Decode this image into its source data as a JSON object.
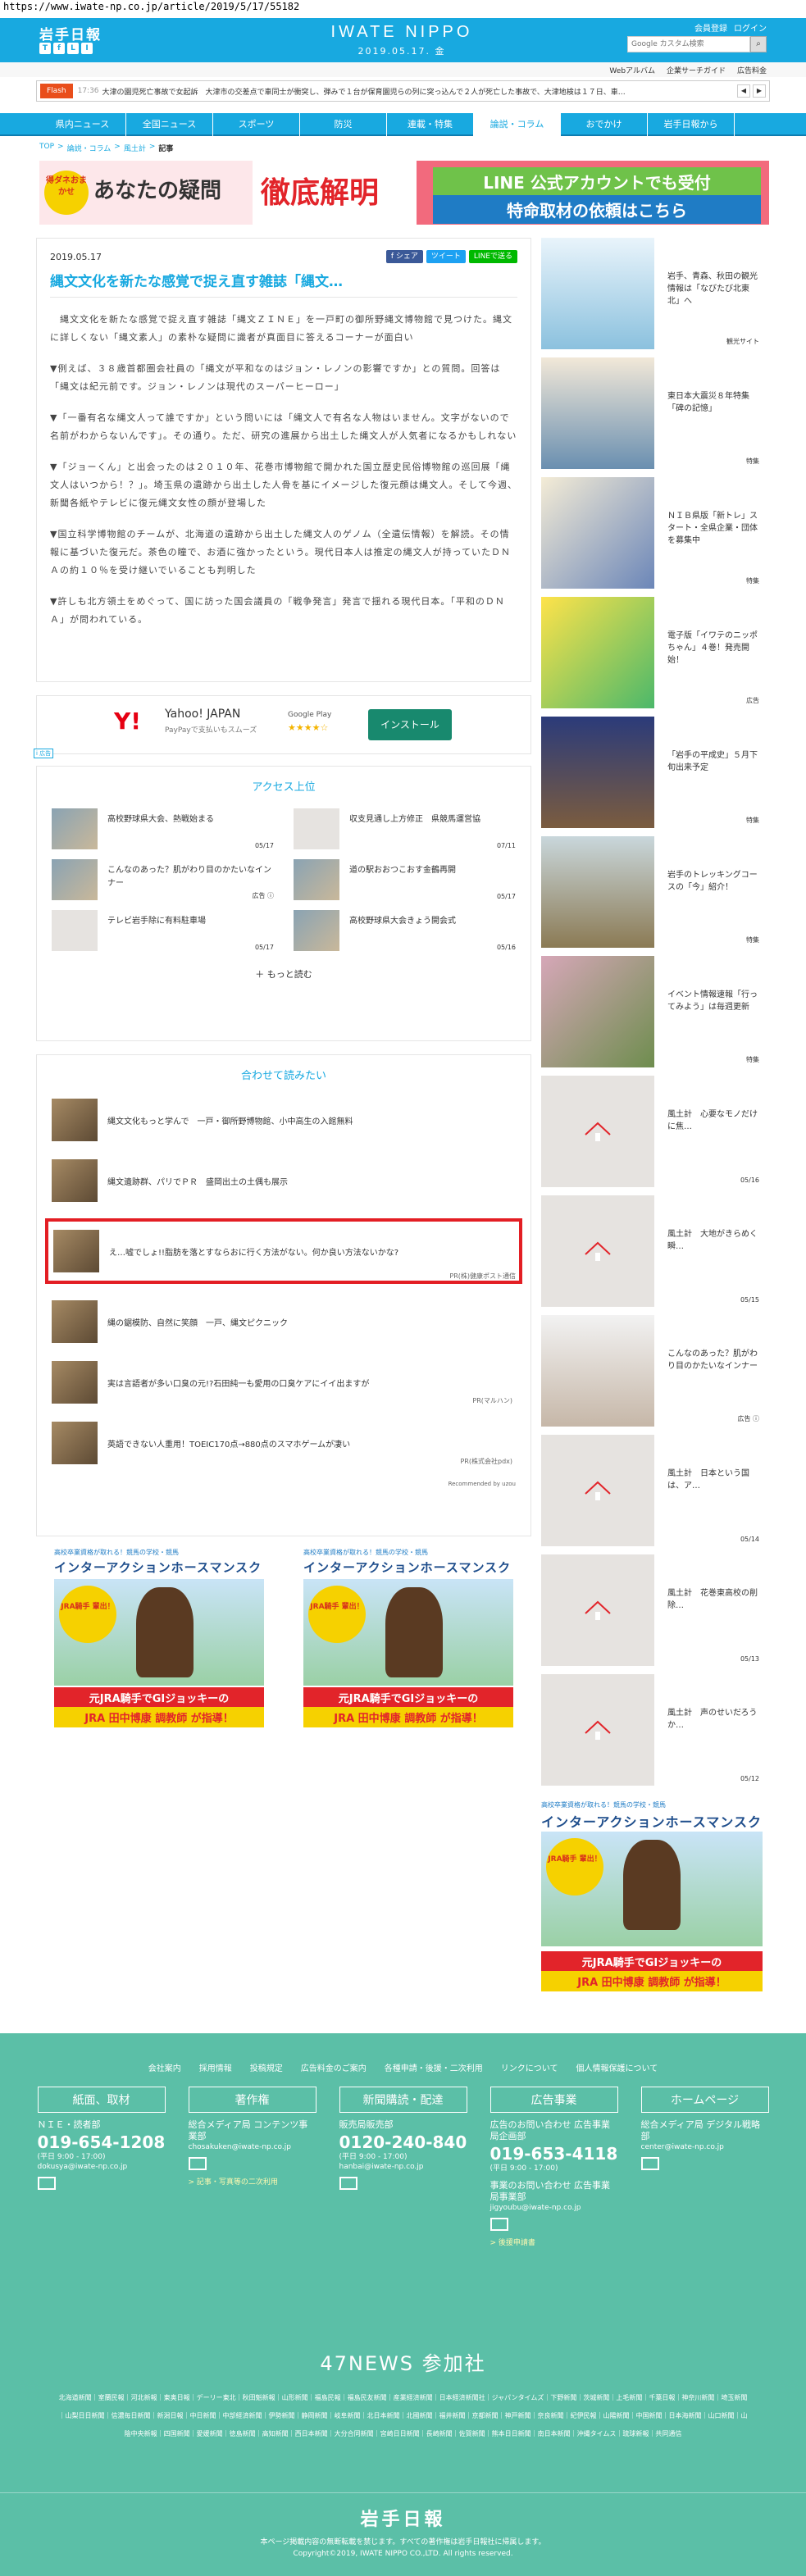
{
  "url": "https://www.iwate-np.co.jp/article/2019/5/17/55182",
  "header": {
    "logo_jp": "岩手日報",
    "logo_en": "IWATE NIPPO",
    "date": "2019.05.17. 金",
    "links": [
      "会員登録",
      "ログイン"
    ],
    "search_placeholder": "Google カスタム検索",
    "search_icon": "magnifier-icon",
    "social": [
      "T",
      "f",
      "L",
      "I"
    ]
  },
  "subbar": {
    "links": [
      "Webアルバム",
      "企業サーチガイド",
      "広告料金"
    ]
  },
  "flash": {
    "label": "Flash",
    "time": "17:36",
    "text": "大津の園児死亡事故で女起訴　大津市の交差点で車同士が衝突し、弾みで１台が保育園児らの列に突っ込んで２人が死亡した事故で、大津地検は１７日、車…"
  },
  "nav": [
    "県内ニュース",
    "全国ニュース",
    "スポーツ",
    "防災",
    "連載・特集",
    "論説・コラム",
    "おでかけ",
    "岩手日報から"
  ],
  "nav_active": 5,
  "breadcrumb": [
    "TOP",
    "論説・コラム",
    "風土計",
    "記事"
  ],
  "banner": {
    "badge": "得ダネおまかせ",
    "left": "あなたの疑問",
    "mid": "徹底解明",
    "line1": "LINE 公式アカウントでも受付",
    "line2": "特命取材の依頼はこちら"
  },
  "article": {
    "date": "2019.05.17",
    "shares": [
      "f シェア",
      "ツイート",
      "LINEで送る"
    ],
    "title": "縄文文化を新たな感覚で捉え直す雑誌「縄文…",
    "paragraphs": [
      "　縄文文化を新たな感覚で捉え直す雑誌「縄文ＺＩＮＥ」を一戸町の御所野縄文博物館で見つけた。縄文に詳しくない「縄文素人」の素朴な疑問に識者が真面目に答えるコーナーが面白い",
      "▼例えば、３８歳首都圏会社員の「縄文が平和なのはジョン・レノンの影響ですか」との質問。回答は「縄文は紀元前です。ジョン・レノンは現代のスーパーヒーロー」",
      "▼「一番有名な縄文人って誰ですか」という問いには「縄文人で有名な人物はいません。文字がないので名前がわからないんです」。その通り。ただ、研究の進展から出土した縄文人が人気者になるかもしれない",
      "▼「ジョーくん」と出会ったのは２０１０年、花巻市博物館で開かれた国立歴史民俗博物館の巡回展「縄文人はいつから！？」。埼玉県の遺跡から出土した人骨を基にイメージした復元顔は縄文人。そして今週、新聞各紙やテレビに復元縄文女性の顔が登場した",
      "▼国立科学博物館のチームが、北海道の遺跡から出土した縄文人のゲノム（全遺伝情報）を解読。その情報に基づいた復元だ。茶色の瞳で、お酒に強かったという。現代日本人は推定の縄文人が持っていたＤＮＡの約１０％を受け継いでいることも判明した",
      "▼許しも北方領土をめぐって、国に訪った国会議員の「戦争発言」発言で揺れる現代日本。「平和のＤＮＡ」が問われている。"
    ]
  },
  "app_ad": {
    "logo": "Y!",
    "name": "Yahoo! JAPAN",
    "desc": "PayPayで支払いもスムーズ",
    "store": "Google Play",
    "stars": "★★★★☆",
    "button": "インストール",
    "tag": "i 広告"
  },
  "ranking": {
    "title": "アクセス上位",
    "items": [
      {
        "title": "高校野球県大会、熱戦始まる",
        "date": "05/17",
        "thumb": "photo"
      },
      {
        "title": "収支見通し上方修正　県競馬運営協",
        "date": "07/11",
        "thumb": "gray"
      },
      {
        "title": "こんなのあった？肌がわり目のかたいなインナー",
        "date": "広告 ⓘ",
        "thumb": "photo"
      },
      {
        "title": "道の駅おおつこおす金鶴再開",
        "date": "05/17",
        "thumb": "photo"
      },
      {
        "title": "テレビ岩手除に有料駐車場",
        "date": "05/17",
        "thumb": "gray"
      },
      {
        "title": "高校野球県大会きょう開会式",
        "date": "05/16",
        "thumb": "photo"
      }
    ],
    "more": "＋ もっと読む"
  },
  "related": {
    "title": "合わせて読みたい",
    "items": [
      {
        "title": "縄文文化もっと学んで　一戸・御所野博物館、小中高生の入館無料",
        "sponsor": ""
      },
      {
        "title": "縄文遺跡群、パリでＰＲ　盛岡出土の土偶も展示",
        "sponsor": ""
      },
      {
        "title": "え…嘘でしょ!!脂肪を落とすならおに行く方法がない。何か良い方法ないかな?",
        "sponsor": "PR(株)健康ポスト通信",
        "highlight": true
      },
      {
        "title": "縄の鋸模防、自然に笑顔　一戸、縄文ピクニック",
        "sponsor": ""
      },
      {
        "title": "実は言語者が多い口臭の元!?石田純一も愛用の口臭ケアにイイ出ますが",
        "sponsor": "PR(マルハン)"
      },
      {
        "title": "英語できない人重用！TOEIC170点→880点のスマホゲームが凄い",
        "sponsor": "PR(株式会社pdx)"
      }
    ],
    "powered": "Recommended by uzou"
  },
  "horse_ad": {
    "top": "高校卒業資格が取れる！競馬の学校・競馬",
    "title": "インターアクションホースマンスクール",
    "badge": "JRA騎手 輩出！",
    "cap1": "元JRA騎手でGⅠジョッキーの",
    "cap2": "JRA 田中博康 調教師 が指導！"
  },
  "sidebar": {
    "items": [
      {
        "title": "岩手、青森、秋田の観光情報は「なびたび北東北」へ",
        "src": "観光サイト",
        "kind": "photo1"
      },
      {
        "title": "東日本大震災８年特集「碑の記憶」",
        "src": "特集",
        "kind": "photo2"
      },
      {
        "title": "ＮＩＢ県版「新トレ」スタート・全県企業・団体を募集中",
        "src": "特集",
        "kind": "photo3"
      },
      {
        "title": "電子版「イワテのニッポちゃん」４巻！発売開始！",
        "src": "広告",
        "kind": "photo4"
      },
      {
        "title": "「岩手の平成史」５月下旬出来予定",
        "src": "特集",
        "kind": "photo5"
      },
      {
        "title": "岩手のトレッキングコースの「今」紹介！",
        "src": "特集",
        "kind": "photo6"
      },
      {
        "title": "イベント情報速報「行ってみよう」は毎週更新",
        "src": "特集",
        "kind": "photo7"
      },
      {
        "title": "風土計　心要なモノだけに焦…",
        "src": "05/16",
        "kind": "gray"
      },
      {
        "title": "風土計　大地がきらめく瞬…",
        "src": "05/15",
        "kind": "gray"
      },
      {
        "title": "こんなのあった？肌がわり目のかたいなインナー",
        "src": "広告 ⓘ",
        "kind": "photo8"
      },
      {
        "title": "風土計　日本という国は、ア…",
        "src": "05/14",
        "kind": "gray"
      },
      {
        "title": "風土計　花巻東高校の削除…",
        "src": "05/13",
        "kind": "gray"
      },
      {
        "title": "風土計　声のせいだろうか…",
        "src": "05/12",
        "kind": "gray"
      }
    ]
  },
  "footer": {
    "top_links": [
      "会社案内",
      "採用情報",
      "投稿規定",
      "広告料金のご案内",
      "各種申請・後援・二次利用",
      "リンクについて",
      "個人情報保護について"
    ],
    "cols": [
      {
        "head": "紙面、取材",
        "sub": "ＮＩＥ・読者部",
        "phone": "019-654-1208",
        "hours": "(平日 9:00 - 17:00)",
        "mail": "dokusya@iwate-np.co.jp",
        "link": ""
      },
      {
        "head": "著作権",
        "sub": "総合メディア局 コンテンツ事業部",
        "phone": "",
        "hours": "",
        "mail": "chosakuken@iwate-np.co.jp",
        "link": "> 記事・写真等の二次利用"
      },
      {
        "head": "新聞購読・配達",
        "sub": "販売局販売部",
        "phone": "0120-240-840",
        "hours": "(平日 9:00 - 17:00)",
        "mail": "hanbai@iwate-np.co.jp",
        "link": ""
      },
      {
        "head": "広告事業",
        "sub": "広告のお問い合わせ 広告事業局企画部",
        "phone": "019-653-4118",
        "hours": "(平日 9:00 - 17:00)",
        "mail": "jigyoubu@iwate-np.co.jp",
        "link": "> 後援申請書"
      },
      {
        "head": "ホームページ",
        "sub": "総合メディア局 デジタル戦略部",
        "phone": "",
        "hours": "",
        "mail": "center@iwate-np.co.jp",
        "link": ""
      }
    ],
    "biz_sub": "事業のお問い合わせ 広告事業局事業部",
    "news47": "47NEWS 参加社",
    "papers": "北海道新聞｜室蘭民報｜河北新報｜東奥日報｜デーリー東北｜秋田魁新報｜山形新聞｜福島民報｜福島民友新聞｜産業経済新聞｜日本経済新聞社｜ジャパンタイムズ｜下野新聞｜茨城新聞｜上毛新聞｜千葉日報｜神奈川新聞｜埼玉新聞｜山梨日日新聞｜信濃毎日新聞｜新潟日報｜中日新聞｜中部経済新聞｜伊勢新聞｜静岡新聞｜岐阜新聞｜北日本新聞｜北國新聞｜福井新聞｜京都新聞｜神戸新聞｜奈良新聞｜紀伊民報｜山陽新聞｜中国新聞｜日本海新聞｜山口新聞｜山陰中央新報｜四国新聞｜愛媛新聞｜徳島新聞｜高知新聞｜西日本新聞｜大分合同新聞｜宮崎日日新聞｜長崎新聞｜佐賀新聞｜熊本日日新聞｜南日本新聞｜沖縄タイムス｜琉球新報｜共同通信",
    "logo": "岩手日報",
    "note": "本ページ掲載内容の無断転載を禁じます。すべての著作権は岩手日報社に帰属します。",
    "copy": "Copyright©2019, IWATE NIPPO CO.,LTD. All rights reserved."
  }
}
